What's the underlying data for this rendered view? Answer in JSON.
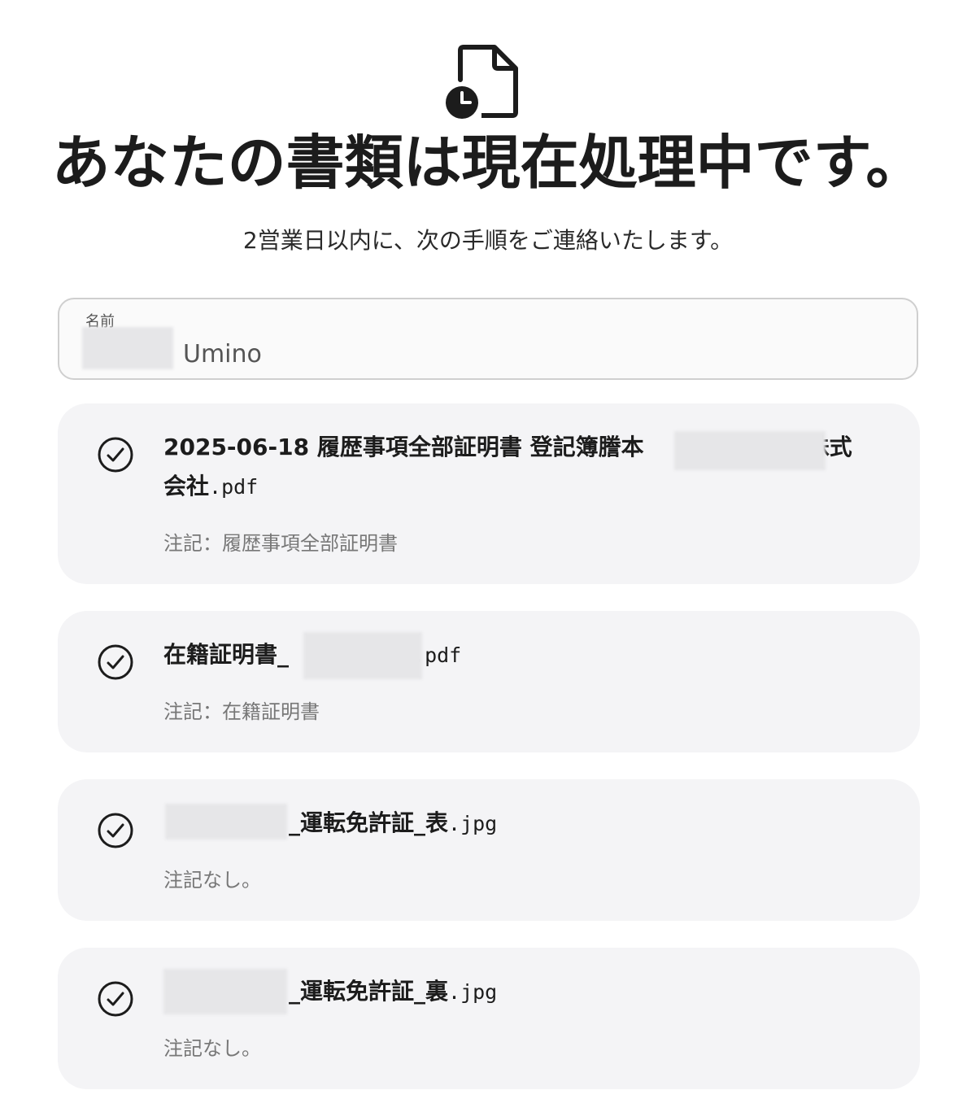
{
  "header": {
    "icon": "document-clock-icon",
    "title": "あなたの書類は現在処理中です。",
    "subtitle": "2営業日以内に、次の手順をご連絡いたします。"
  },
  "name_field": {
    "label": "名前",
    "value": "Umino"
  },
  "documents": [
    {
      "status_icon": "check-circle-icon",
      "name_part1": "2025-06-18 履歴事項全部証明書 登記簿謄本",
      "name_part2": "株式",
      "name_part3": "会社",
      "extension": ".pdf",
      "note": "注記：履歴事項全部証明書"
    },
    {
      "status_icon": "check-circle-icon",
      "name_part1": "在籍証明書_",
      "extension": ".pdf",
      "note": "注記：在籍証明書"
    },
    {
      "status_icon": "check-circle-icon",
      "name_part1": "_運転免許証_表",
      "extension": ".jpg",
      "note": "注記なし。"
    },
    {
      "status_icon": "check-circle-icon",
      "name_part1": "_運転免許証_裏",
      "extension": ".jpg",
      "note": "注記なし。"
    }
  ]
}
